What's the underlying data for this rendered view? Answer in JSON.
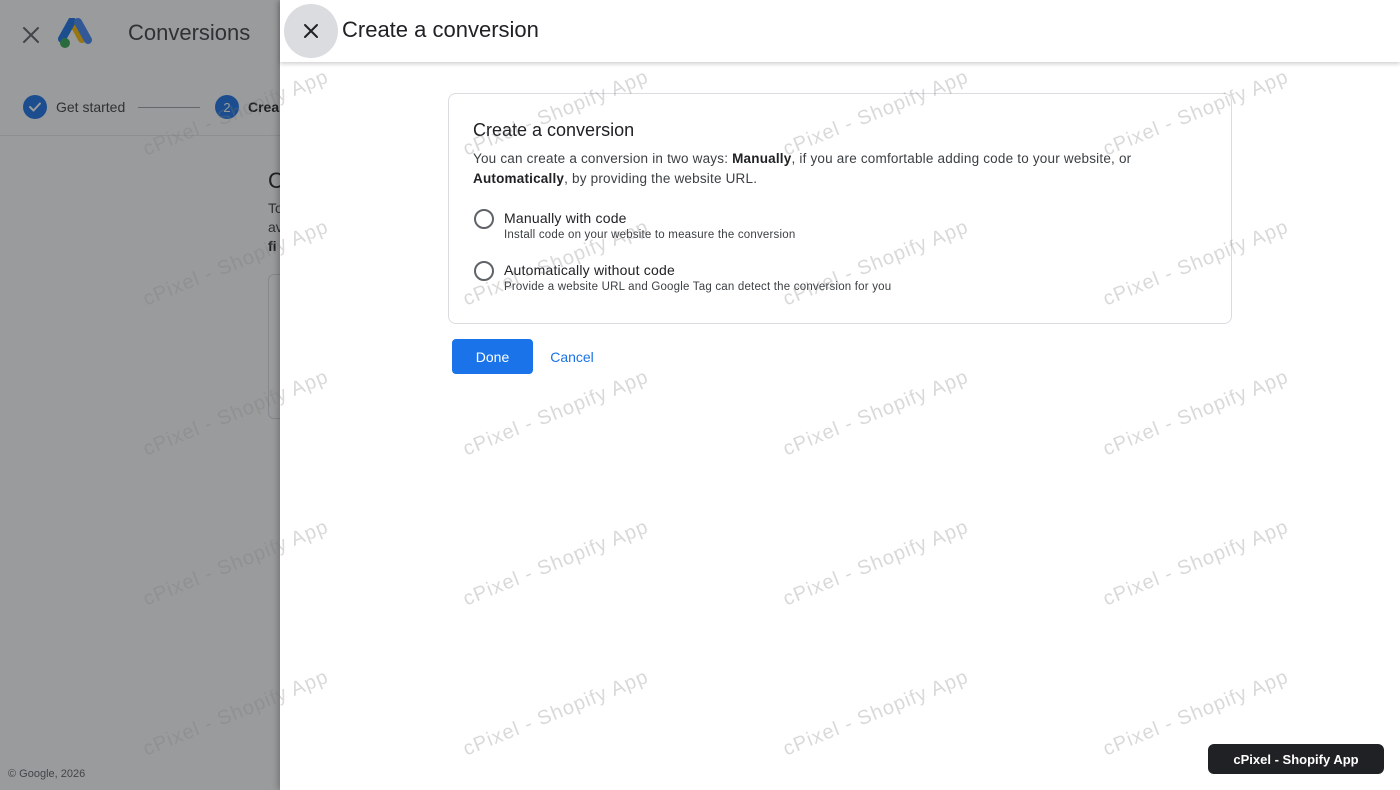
{
  "background": {
    "app_title": "Conversions",
    "stepper": {
      "step1_label": "Get started",
      "step2_number": "2",
      "step2_label_partial": "Crea"
    },
    "heading_partial": "C",
    "line1_partial": "To",
    "line2_partial": "av",
    "line3_partial": "fi",
    "footer": "© Google, 2026"
  },
  "panel": {
    "title": "Create a conversion",
    "card": {
      "title": "Create a conversion",
      "desc_part1": "You can create a conversion in two ways: ",
      "desc_bold1": "Manually",
      "desc_part2": ", if you are comfortable adding code to your website, or ",
      "desc_bold2": "Automatically",
      "desc_part3": ", by providing the website URL.",
      "options": [
        {
          "label": "Manually with code",
          "description": "Install code on your website to measure the conversion"
        },
        {
          "label": "Automatically without code",
          "description": "Provide a website URL and Google Tag can detect the conversion for you"
        }
      ]
    },
    "done_label": "Done",
    "cancel_label": "Cancel"
  },
  "watermark": {
    "text": "cPixel - Shopify App",
    "badge": "cPixel - Shopify App"
  },
  "colors": {
    "primary": "#1a73e8",
    "scrim": "#202124",
    "badge_bg": "#202124"
  }
}
